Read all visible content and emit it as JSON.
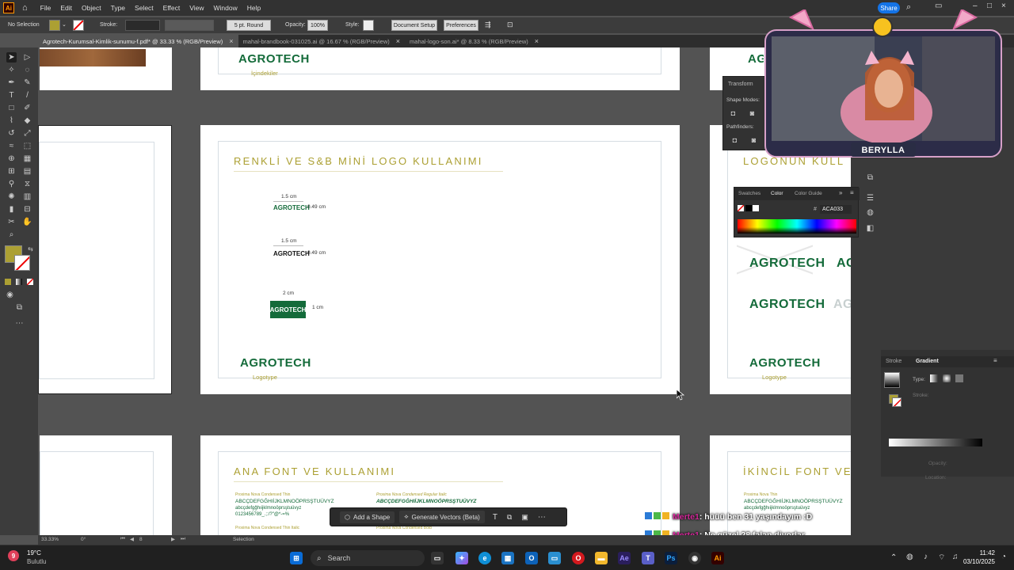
{
  "menubar": {
    "logo": "Ai",
    "items": [
      "File",
      "Edit",
      "Object",
      "Type",
      "Select",
      "Effect",
      "View",
      "Window",
      "Help"
    ],
    "share": "Share"
  },
  "control": {
    "selection": "No Selection",
    "stroke_label": "Stroke:",
    "stroke_weight": "5 pt. Round",
    "opacity_label": "Opacity:",
    "opacity": "100%",
    "style_label": "Style:",
    "doc_setup": "Document Setup",
    "preferences": "Preferences",
    "fill_color": "#aca033"
  },
  "tabs": [
    {
      "label": "Agrotech-Kurumsal-Kimlik-sunumu-f.pdf* @ 33.33 % (RGB/Preview)",
      "close": "×"
    },
    {
      "label": "mahal-brandbook-031025.ai @ 16.67 % (RGB/Preview)",
      "close": "×"
    },
    {
      "label": "mahal-logo-son.ai* @ 8.33 % (RGB/Preview)",
      "close": "×"
    }
  ],
  "artboards": {
    "top": {
      "logo": "AGROTECH",
      "caption": "İçindekiler"
    },
    "main": {
      "heading": "RENKLİ VE S&B MİNİ LOGO KULLANIMI",
      "items": [
        {
          "width": "1.5 cm",
          "height": "0.49 cm",
          "logo": "AGROTECH"
        },
        {
          "width": "1.5 cm",
          "height": "0.49 cm",
          "logo": "AGROTECH"
        },
        {
          "width": "2 cm",
          "height": "1 cm",
          "logo": "AGROTECH"
        }
      ],
      "footer_logo": "AGROTECH",
      "footer_caption": "Logotype"
    },
    "right": {
      "heading": "LOGONUN KULL",
      "logos": [
        "AGROTECH",
        "AG",
        "AGROTECH",
        "AG"
      ],
      "footer_logo": "AGROTECH",
      "footer_caption": "Logotype"
    },
    "bottom": {
      "heading": "ANA FONT VE KULLANIMI",
      "font1_name": "Proxima Nova Condensed Thin",
      "font1_upper": "ABCÇDEFGĞHIİJKLMNOÖPRSŞTUÜVYZ",
      "font1_lower": "abcçdefgğhıijklmnoöprsştuüvyz",
      "font1_nums": "0123456789_.;:/?\"@*-=%",
      "font2_name": "Proxima Nova Condensed Regular Italic",
      "font2_upper": "ABCÇDEFGĞHIİJKLMNOÖPRSŞTUÜVYZ",
      "font3_name": "Proxima Nova Condensed Thin Italic",
      "font4_name": "Proxima Nova Condensed Bold"
    },
    "bottom_right": {
      "heading": "İKİNCİL FONT VE",
      "font_name": "Proxima Nova Thin",
      "font_upper": "ABCÇDEFGĞHIİJKLMNOÖPRSŞTUÜVYZ",
      "font_lower": "abcçdefgğhıijklmnoöprsştuüvyz"
    }
  },
  "context_bar": {
    "add_shape": "Add a Shape",
    "generate": "Generate Vectors (Beta)"
  },
  "panels": {
    "transform": "Transform",
    "shape_modes": "Shape Modes:",
    "pathfinders": "Pathfinders:",
    "swatches": "Swatches",
    "color": "Color",
    "color_guide": "Color Guide",
    "hex_label": "#",
    "hex": "ACA033",
    "stroke": "Stroke",
    "gradient": "Gradient",
    "type_label": "Type:",
    "stroke_label": "Stroke:",
    "opacity_label": "Opacity:",
    "location_label": "Location:"
  },
  "status": {
    "zoom": "33.33%",
    "angle": "0°",
    "page": "8",
    "tool": "Selection"
  },
  "webcam": {
    "name": "BERYLLA"
  },
  "chat": [
    {
      "user": "Merte1",
      "msg": ": hüüü ben 31 yaşındayım :D"
    },
    {
      "user": "Merte1",
      "msg": ": Ne güzel 28 falan diyorlar"
    }
  ],
  "taskbar": {
    "temp": "19°C",
    "weather": "Bulutlu",
    "search": "Search",
    "time": "11:42",
    "date": "03/10/2025",
    "badge": "9"
  }
}
